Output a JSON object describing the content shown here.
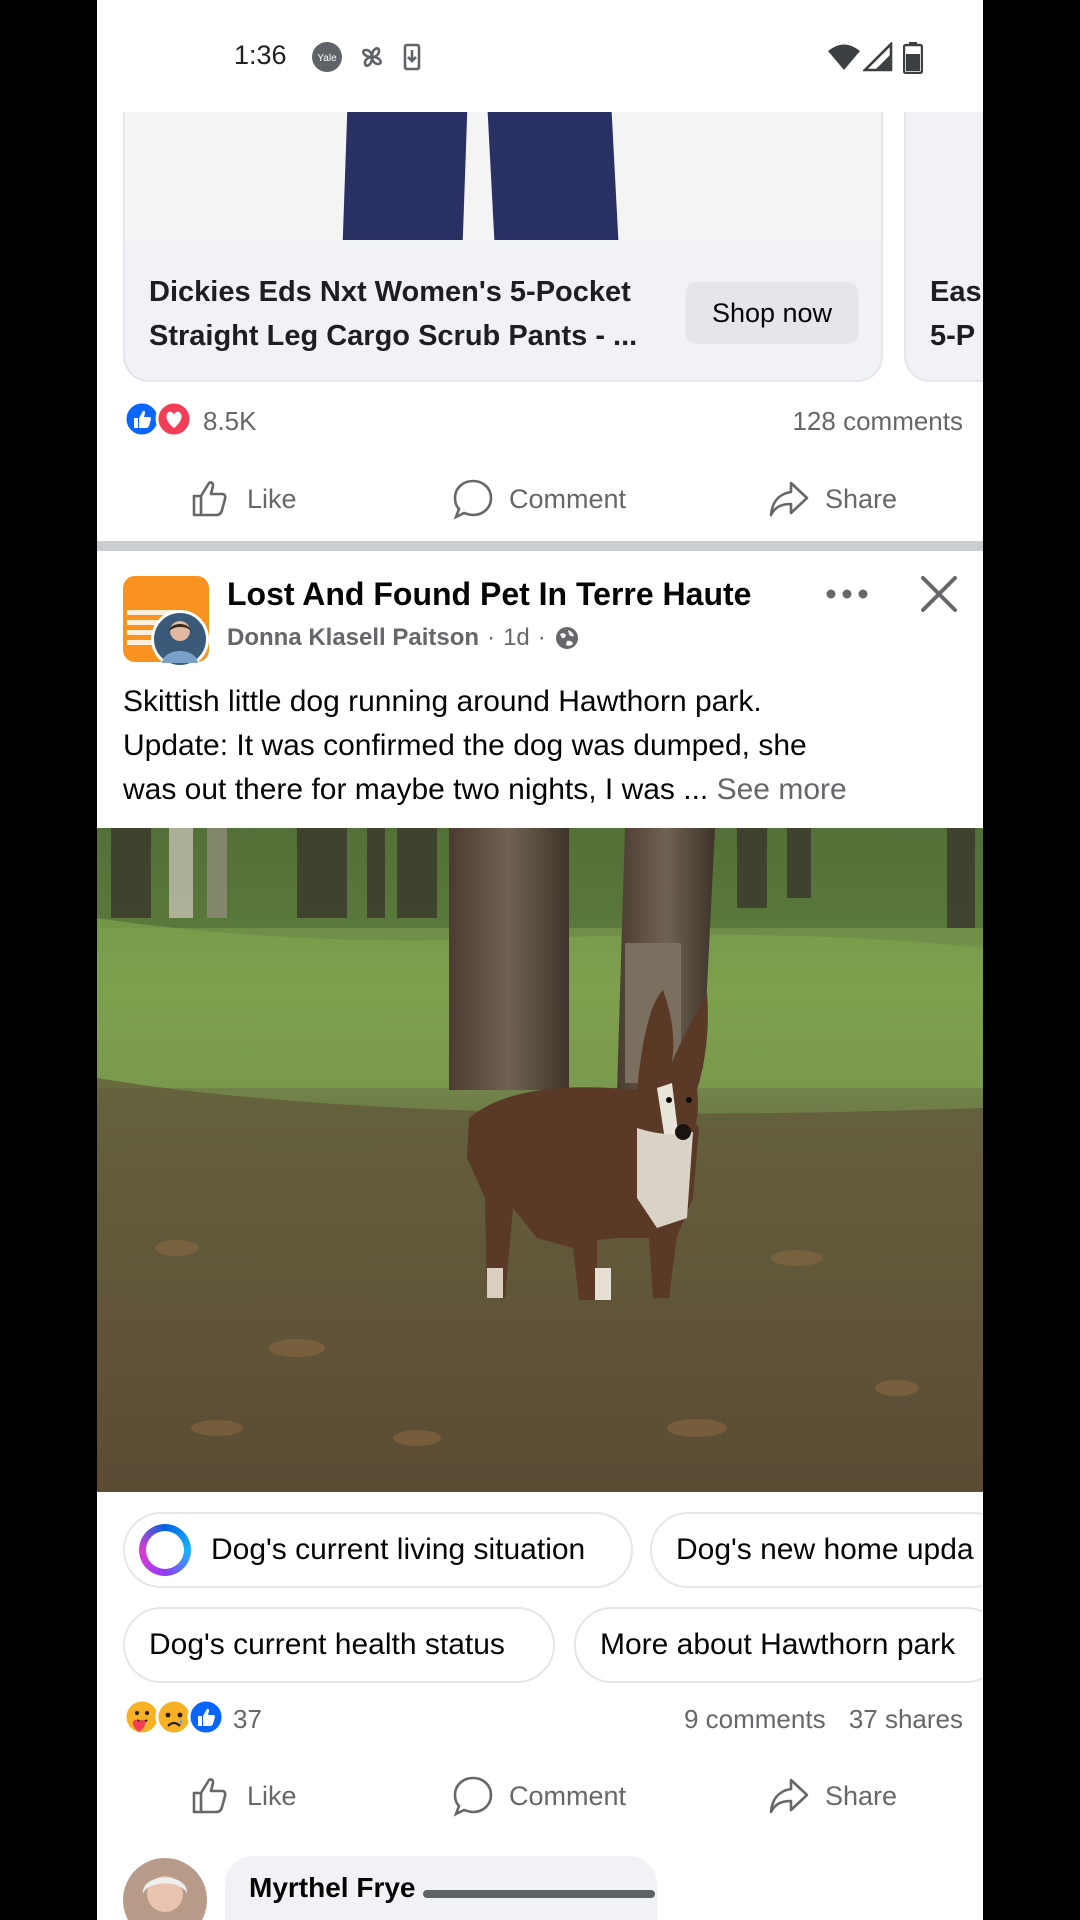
{
  "status_bar": {
    "time": "1:36",
    "left_icons": [
      "yale-app-icon",
      "pinwheel-icon",
      "download-icon"
    ],
    "right_icons": [
      "wifi-icon",
      "cell-signal-icon",
      "battery-icon"
    ]
  },
  "ad": {
    "title_line1": "Dickies Eds Nxt Women's 5-Pocket",
    "title_line2": "Straight Leg Cargo Scrub Pants - ...",
    "cta": "Shop now",
    "next_card_line1": "Eas",
    "next_card_line2": "5-P"
  },
  "ad_post_stats": {
    "reactions": [
      "like-reaction-icon",
      "love-reaction-icon"
    ],
    "reaction_count": "8.5K",
    "comments": "128 comments"
  },
  "actions": {
    "like": "Like",
    "comment": "Comment",
    "share": "Share"
  },
  "post": {
    "group_name": "Lost And Found Pet In Terre Haute",
    "author": "Donna Klasell Paitson",
    "time": "1d",
    "privacy_icon": "globe-icon",
    "text_line1": "Skittish little dog running around  Hawthorn park.",
    "text_line2": "Update: It was confirmed the dog was dumped, she",
    "text_line3": "was out there for maybe two nights, I was ...",
    "see_more": "See more"
  },
  "chips": {
    "row1": [
      "Dog's current living situation",
      "Dog's new home upda"
    ],
    "row2": [
      "Dog's current health status",
      "More about Hawthorn park"
    ]
  },
  "post_stats": {
    "reactions": [
      "care-reaction-icon",
      "sad-reaction-icon",
      "like-reaction-icon"
    ],
    "reaction_count": "37",
    "comments": "9 comments",
    "shares": "37 shares"
  },
  "comment_preview": {
    "name": "Myrthel Frye"
  },
  "colors": {
    "facebook_blue": "#0866ff",
    "love_red": "#f33e58",
    "secondary_text": "#65676b",
    "divider": "#c9ccd1"
  }
}
